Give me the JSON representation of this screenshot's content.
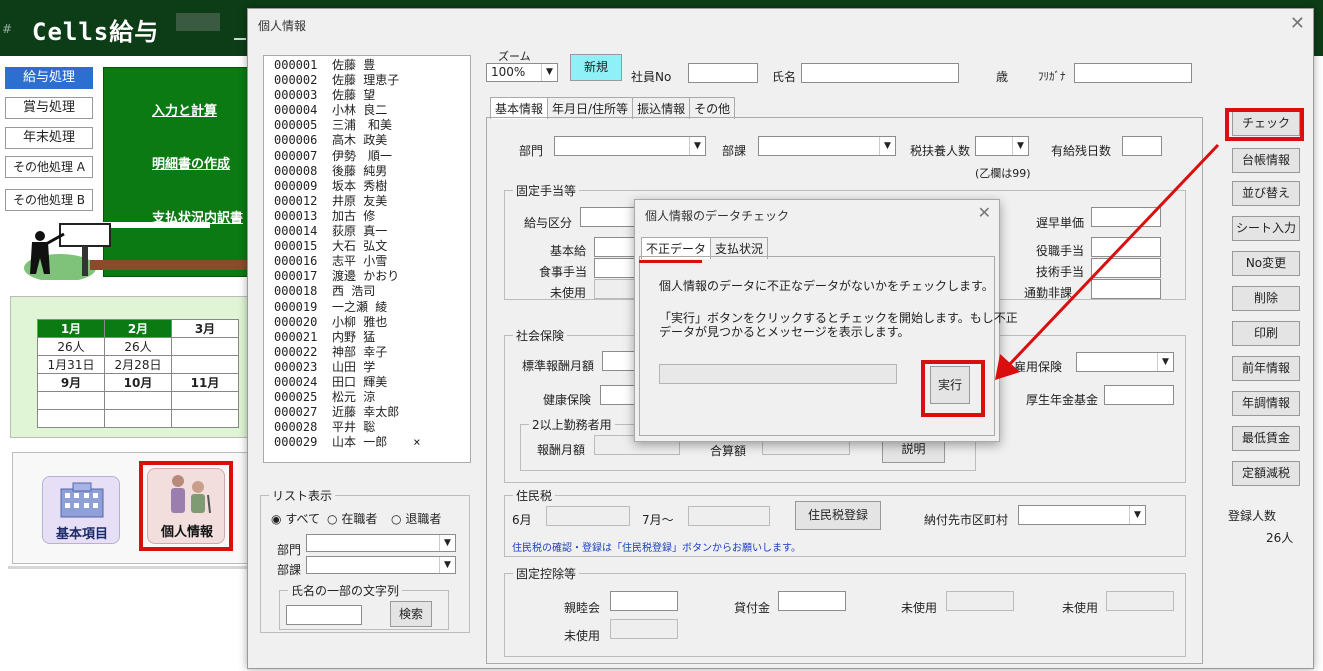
{
  "app": {
    "hash": "#",
    "title": "Cells給与"
  },
  "sidebar": {
    "items": [
      {
        "label": "給与処理",
        "active": true
      },
      {
        "label": "賞与処理",
        "active": false
      },
      {
        "label": "年末処理",
        "active": false
      },
      {
        "label": "その他処理 A",
        "active": false
      },
      {
        "label": "その他処理 B",
        "active": false
      }
    ]
  },
  "board": {
    "links": [
      "入力と計算",
      "明細書の作成",
      "支払状況内訳書"
    ]
  },
  "calendar": {
    "row1": [
      "1月",
      "2月",
      "3月"
    ],
    "row2": [
      "26人",
      "26人",
      ""
    ],
    "row3": [
      "1月31日",
      "2月28日",
      ""
    ],
    "row4": [
      "9月",
      "10月",
      "11月"
    ]
  },
  "icons": {
    "basic": "基本項目",
    "personal": "個人情報"
  },
  "dialog": {
    "title": "個人情報",
    "close": "✕",
    "employees": [
      {
        "no": "000001",
        "name": "佐藤 豊",
        "mark": ""
      },
      {
        "no": "000002",
        "name": "佐藤 理恵子",
        "mark": ""
      },
      {
        "no": "000003",
        "name": "佐藤 望",
        "mark": ""
      },
      {
        "no": "000004",
        "name": "小林 良二",
        "mark": ""
      },
      {
        "no": "000005",
        "name": "三浦　和美",
        "mark": ""
      },
      {
        "no": "000006",
        "name": "高木 政美",
        "mark": ""
      },
      {
        "no": "000007",
        "name": "伊勢　順一",
        "mark": ""
      },
      {
        "no": "000008",
        "name": "後藤 純男",
        "mark": ""
      },
      {
        "no": "000009",
        "name": "坂本 秀樹",
        "mark": ""
      },
      {
        "no": "000012",
        "name": "井原 友美",
        "mark": ""
      },
      {
        "no": "000013",
        "name": "加古 修",
        "mark": ""
      },
      {
        "no": "000014",
        "name": "荻原 真一",
        "mark": ""
      },
      {
        "no": "000015",
        "name": "大石 弘文",
        "mark": ""
      },
      {
        "no": "000016",
        "name": "志平 小雪",
        "mark": ""
      },
      {
        "no": "000017",
        "name": "渡邊 かおり",
        "mark": ""
      },
      {
        "no": "000018",
        "name": "西 浩司",
        "mark": ""
      },
      {
        "no": "000019",
        "name": "一之瀬 綾",
        "mark": ""
      },
      {
        "no": "000020",
        "name": "小柳 雅也",
        "mark": ""
      },
      {
        "no": "000021",
        "name": "内野 猛",
        "mark": ""
      },
      {
        "no": "000022",
        "name": "神部 幸子",
        "mark": ""
      },
      {
        "no": "000023",
        "name": "山田 学",
        "mark": ""
      },
      {
        "no": "000024",
        "name": "田口 輝美",
        "mark": ""
      },
      {
        "no": "000025",
        "name": "松元 涼",
        "mark": ""
      },
      {
        "no": "000027",
        "name": "近藤 幸太郎",
        "mark": ""
      },
      {
        "no": "000028",
        "name": "平井 聡",
        "mark": ""
      },
      {
        "no": "000029",
        "name": "山本 一郎",
        "mark": "×"
      }
    ],
    "list_display": {
      "title": "リスト表示",
      "options": [
        "すべて",
        "在職者",
        "退職者"
      ],
      "selected": 0,
      "dept_label": "部門",
      "section_label": "部課",
      "name_search": {
        "title": "氏名の一部の文字列",
        "button": "検索"
      }
    },
    "top": {
      "zoom_label": "ズーム",
      "zoom_value": "100%",
      "new_button": "新規",
      "emp_no_label": "社員No",
      "name_label": "氏名",
      "age_label": "歳",
      "furigana_label": "ﾌﾘｶﾞﾅ"
    },
    "tabs": [
      "基本情報",
      "年月日/住所等",
      "振込情報",
      "その他"
    ],
    "basic": {
      "dept": "部門",
      "section": "部課",
      "dependents": "税扶養人数",
      "dependents_note": "(乙欄は99)",
      "paid_leave": "有給残日数"
    },
    "fixed_allowance": {
      "title": "固定手当等",
      "pay_class": "給与区分",
      "base_pay": "基本給",
      "meal": "食事手当",
      "unused": "未使用",
      "late_rate": "遅早単価",
      "position_allowance": "役職手当",
      "skill_allowance": "技術手当",
      "commute_partial": "通勤非課"
    },
    "social_insurance": {
      "title": "社会保険",
      "standard_monthly": "標準報酬月額",
      "health": "健康保険",
      "employment": "雇用保険",
      "pension_fund": "厚生年金基金",
      "multi_work": {
        "title": "2以上勤務者用",
        "pay_monthly": "報酬月額",
        "total": "合算額",
        "explain": "説明"
      }
    },
    "resident_tax": {
      "title": "住民税",
      "june": "6月",
      "july": "7月～",
      "register_button": "住民税登録",
      "city_label": "納付先市区町村",
      "note": "住民税の確認・登録は「住民税登録」ボタンからお願いします。"
    },
    "fixed_deduction": {
      "title": "固定控除等",
      "fellowship": "親睦会",
      "loan": "貸付金",
      "unused1": "未使用",
      "unused2": "未使用",
      "unused3": "未使用"
    },
    "right_buttons": [
      "チェック",
      "台帳情報",
      "並び替え",
      "シート入力",
      "No変更",
      "削除",
      "印刷",
      "前年情報",
      "年調情報",
      "最低賃金",
      "定額減税"
    ],
    "registered": {
      "label": "登録人数",
      "value": "26人"
    }
  },
  "check_dialog": {
    "title": "個人情報のデータチェック",
    "close": "✕",
    "tabs": [
      "不正データ",
      "支払状況"
    ],
    "line1": "個人情報のデータに不正なデータがないかをチェックします。",
    "line2": "「実行」ボタンをクリックするとチェックを開始します。もし不正",
    "line3": "データが見つかるとメッセージを表示します。",
    "run_button": "実行"
  },
  "colors": {
    "header": "#0d3d17",
    "board": "#0b7a12",
    "highlight": "#d90f0f",
    "note": "#1a3fbf"
  }
}
